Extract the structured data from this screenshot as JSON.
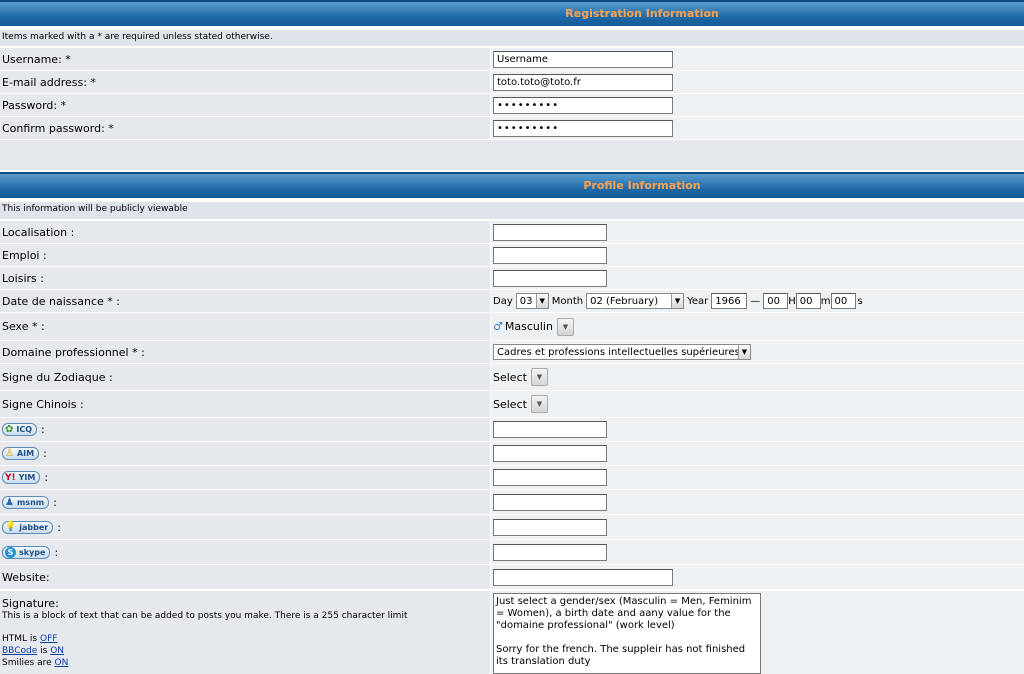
{
  "registration": {
    "header": "Registration Information",
    "note": "Items marked with a * are required unless stated otherwise.",
    "fields": [
      {
        "label": "Username: *",
        "value": "Username"
      },
      {
        "label": "E-mail address: *",
        "value": "toto.toto@toto.fr"
      },
      {
        "label": "Password: *",
        "value": "•••••••••"
      },
      {
        "label": "Confirm password: *",
        "value": "•••••••••"
      }
    ]
  },
  "profile": {
    "header": "Profile Information",
    "note": "This information will be publicly viewable",
    "localisation": "Localisation :",
    "emploi": "Emploi :",
    "loisirs": "Loisirs :",
    "birth": {
      "label": "Date de naissance * :",
      "day_label": "Day",
      "day": "03",
      "month_label": "Month",
      "month": "02 (February)",
      "year_label": "Year",
      "year": "1966",
      "dash": "—",
      "hour": "00",
      "h": "H",
      "min": "00",
      "m": "m",
      "sec": "00",
      "s": "s"
    },
    "sexe": {
      "label": "Sexe * :",
      "value": "Masculin",
      "icon": "♂"
    },
    "domaine": {
      "label": "Domaine professionnel * :",
      "value": "Cadres et professions intellectuelles supérieures"
    },
    "zodiaque": {
      "label": "Signe du Zodiaque :",
      "value": "Select"
    },
    "chinois": {
      "label": "Signe Chinois :",
      "value": "Select"
    },
    "im": [
      {
        "name": "ICQ",
        "icon": "✿"
      },
      {
        "name": "AIM",
        "icon": "♙"
      },
      {
        "name": "YIM",
        "icon": "Y!"
      },
      {
        "name": "msnm",
        "icon": "♟"
      },
      {
        "name": "jabber",
        "icon": "💡"
      },
      {
        "name": "skype",
        "icon": "S"
      }
    ],
    "im_colon": ":",
    "website": "Website:",
    "signature": {
      "label": "Signature:",
      "desc": "This is a block of text that can be added to posts you make. There is a 255 character limit",
      "html": "HTML is",
      "html_state": "OFF",
      "bbcode": "BBCode",
      "bbcode_is": "is",
      "bbcode_state": "ON",
      "smilies": "Smilies are",
      "smilies_state": "ON",
      "text1": "Just select a gender/sex (Masculin = Men, Feminim = Women), a birth date and aany value for the \"domaine professional\" (work level)",
      "text2": "Sorry for the french. The suppleir has not finished its translation duty"
    }
  },
  "colors": {
    "header_text": "#ffa34f",
    "header_bg": "#1f6aa8"
  }
}
